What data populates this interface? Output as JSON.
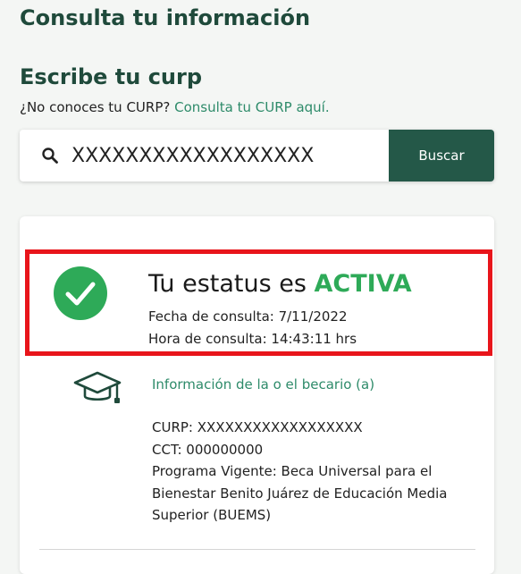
{
  "page": {
    "title": "Consulta tu información"
  },
  "search": {
    "section_title": "Escribe tu curp",
    "hint_text": "¿No conoces tu CURP? ",
    "hint_link": "Consulta tu CURP aquí.",
    "input_value": "XXXXXXXXXXXXXXXXXX",
    "button_label": "Buscar",
    "icon": "search-icon"
  },
  "status": {
    "prefix": "Tu estatus es ",
    "value": "ACTIVA",
    "date_line": "Fecha de consulta: 7/11/2022",
    "time_line": "Hora de consulta: 14:43:11 hrs",
    "icon": "check-circle-icon"
  },
  "becario": {
    "icon": "graduation-cap-icon",
    "title": "Información de la o el becario (a)",
    "curp_line": "CURP: XXXXXXXXXXXXXXXXXX",
    "cct_line": "CCT: 000000000",
    "programa_line": "Programa Vigente: Beca Universal para el Bienestar Benito Juárez de Educación Media Superior (BUEMS)"
  },
  "colors": {
    "primary_dark": "#1f4a3b",
    "button": "#245848",
    "link": "#2e8b6a",
    "status_active": "#2eaa58",
    "highlight_border": "#e8151b"
  }
}
